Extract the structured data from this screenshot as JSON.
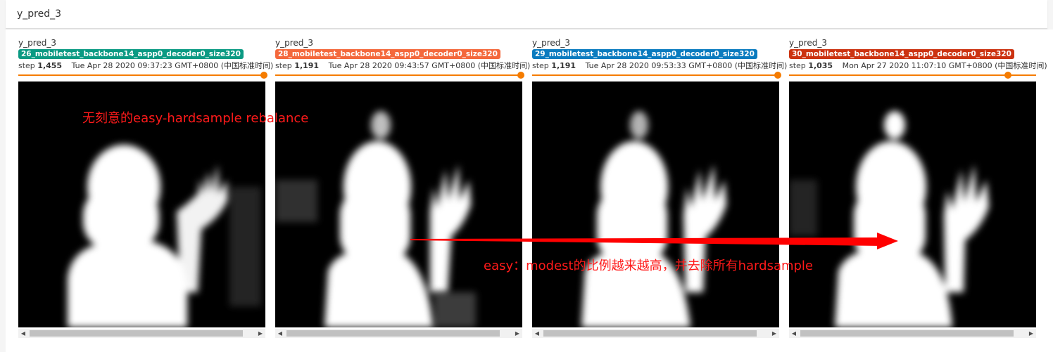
{
  "header": {
    "title": "y_pred_3"
  },
  "cards": [
    {
      "title": "y_pred_3",
      "run": "26_mobiletest_backbone14_aspp0_decoder0_size320",
      "color": "#0b9a83",
      "step_label": "step",
      "step": "1,455",
      "time": "Tue Apr 28 2020 09:37:23 GMT+0800 (中国标准时间)"
    },
    {
      "title": "y_pred_3",
      "run": "28_mobiletest_backbone14_aspp0_decoder0_size320",
      "color": "#f4683c",
      "step_label": "step",
      "step": "1,191",
      "time": "Tue Apr 28 2020 09:43:57 GMT+0800 (中国标准时间)"
    },
    {
      "title": "y_pred_3",
      "run": "29_mobiletest_backbone14_aspp0_decoder0_size320",
      "color": "#0a7bbf",
      "step_label": "step",
      "step": "1,191",
      "time": "Tue Apr 28 2020 09:53:33 GMT+0800 (中国标准时间)"
    },
    {
      "title": "y_pred_3",
      "run": "30_mobiletest_backbone14_aspp0_decoder0_size320",
      "color": "#cc3311",
      "step_label": "step",
      "step": "1,035",
      "time": "Mon Apr 27 2020 11:07:10 GMT+0800 (中国标准时间)"
    }
  ],
  "annotations": {
    "text1": "无刻意的easy-hardsample rebalance",
    "text2": "easy：modest的比例越来越高，并去除所有hardsample"
  },
  "scroll_arrows": {
    "left": "◀",
    "right": "▶"
  },
  "accent_color": "#f57c00"
}
